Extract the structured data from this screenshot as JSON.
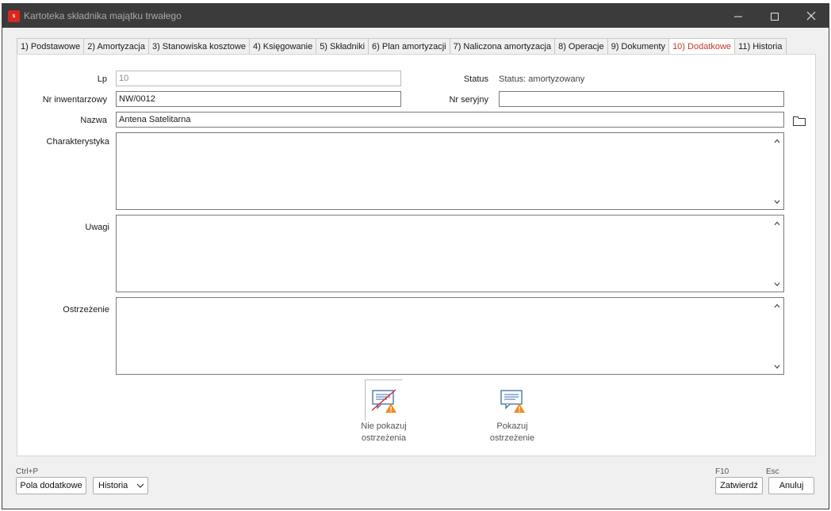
{
  "window": {
    "title": "Kartoteka składnika majątku trwałego",
    "icon_text": "s",
    "icons": {
      "minimize": "minimize-icon",
      "maximize": "maximize-icon",
      "close": "close-icon"
    }
  },
  "tabs": [
    {
      "label": "1) Podstawowe",
      "active": false
    },
    {
      "label": "2) Amortyzacja",
      "active": false
    },
    {
      "label": "3) Stanowiska kosztowe",
      "active": false
    },
    {
      "label": "4) Księgowanie",
      "active": false
    },
    {
      "label": "5) Składniki",
      "active": false
    },
    {
      "label": "6) Plan amortyzacji",
      "active": false
    },
    {
      "label": "7) Naliczona amortyzacja",
      "active": false
    },
    {
      "label": "8) Operacje",
      "active": false
    },
    {
      "label": "9) Dokumenty",
      "active": false
    },
    {
      "label": "10) Dodatkowe",
      "active": true
    },
    {
      "label": "11) Historia",
      "active": false
    }
  ],
  "form": {
    "lp_label": "Lp",
    "lp_value": "10",
    "status_label": "Status",
    "status_value": "Status: amortyzowany",
    "inv_label": "Nr inwentarzowy",
    "inv_value": "NW/0012",
    "serial_label": "Nr seryjny",
    "serial_value": "",
    "name_label": "Nazwa",
    "name_value": "Antena Satelitarna",
    "char_label": "Charakterystyka",
    "char_value": "",
    "notes_label": "Uwagi",
    "notes_value": "",
    "warning_label": "Ostrzeżenie",
    "warning_value": ""
  },
  "warning_buttons": {
    "hide_line1": "Nie pokazuj",
    "hide_line2": "ostrzeżenia",
    "show_line1": "Pokazuj",
    "show_line2": "ostrzeżenie"
  },
  "footer": {
    "extra_hint": "Ctrl+P",
    "extra_button": "Pola dodatkowe",
    "history_select": "Historia",
    "confirm_hint": "F10",
    "confirm_button": "Zatwierdź",
    "cancel_hint": "Esc",
    "cancel_button": "Anuluj"
  },
  "colors": {
    "titlebar": "#3b3b3b",
    "active_tab_text": "#c0392b",
    "app_icon": "#d8281f",
    "warning_triangle": "#f08c1e"
  }
}
